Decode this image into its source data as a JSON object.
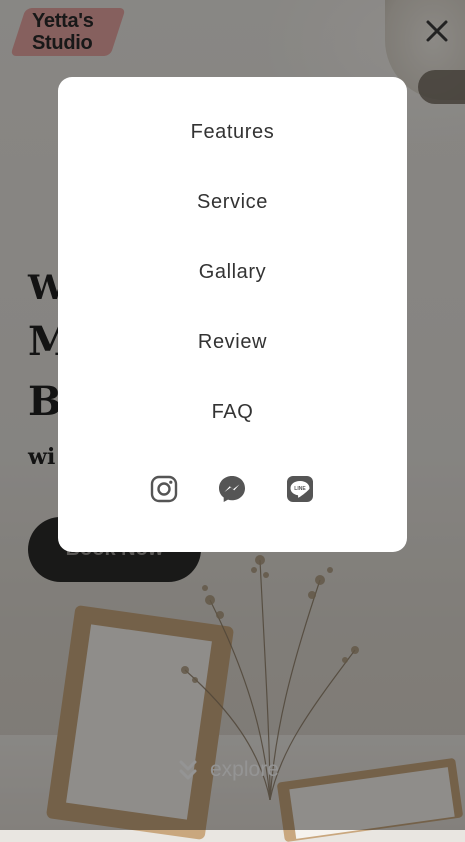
{
  "brand": {
    "logo_line1": "Yetta's",
    "logo_line2": "Studio",
    "logo_color": "#e7a6a3"
  },
  "header": {
    "close_icon": "close-icon"
  },
  "hero": {
    "line1": "W",
    "line2": "M",
    "line3": "B",
    "sub": "wi",
    "cta_label": "Book Now"
  },
  "explore": {
    "label": "explore",
    "icon": "double-chevron-down-icon"
  },
  "menu": {
    "items": [
      {
        "label": "Features"
      },
      {
        "label": "Service"
      },
      {
        "label": "Gallary"
      },
      {
        "label": "Review"
      },
      {
        "label": "FAQ"
      }
    ],
    "social": [
      {
        "icon": "instagram-icon"
      },
      {
        "icon": "messenger-icon"
      },
      {
        "icon": "line-icon",
        "label": "LINE"
      }
    ]
  },
  "colors": {
    "overlay": "rgba(0,0,0,0.42)",
    "menu_bg": "#ffffff",
    "menu_text": "#333333",
    "icon": "#555555"
  }
}
